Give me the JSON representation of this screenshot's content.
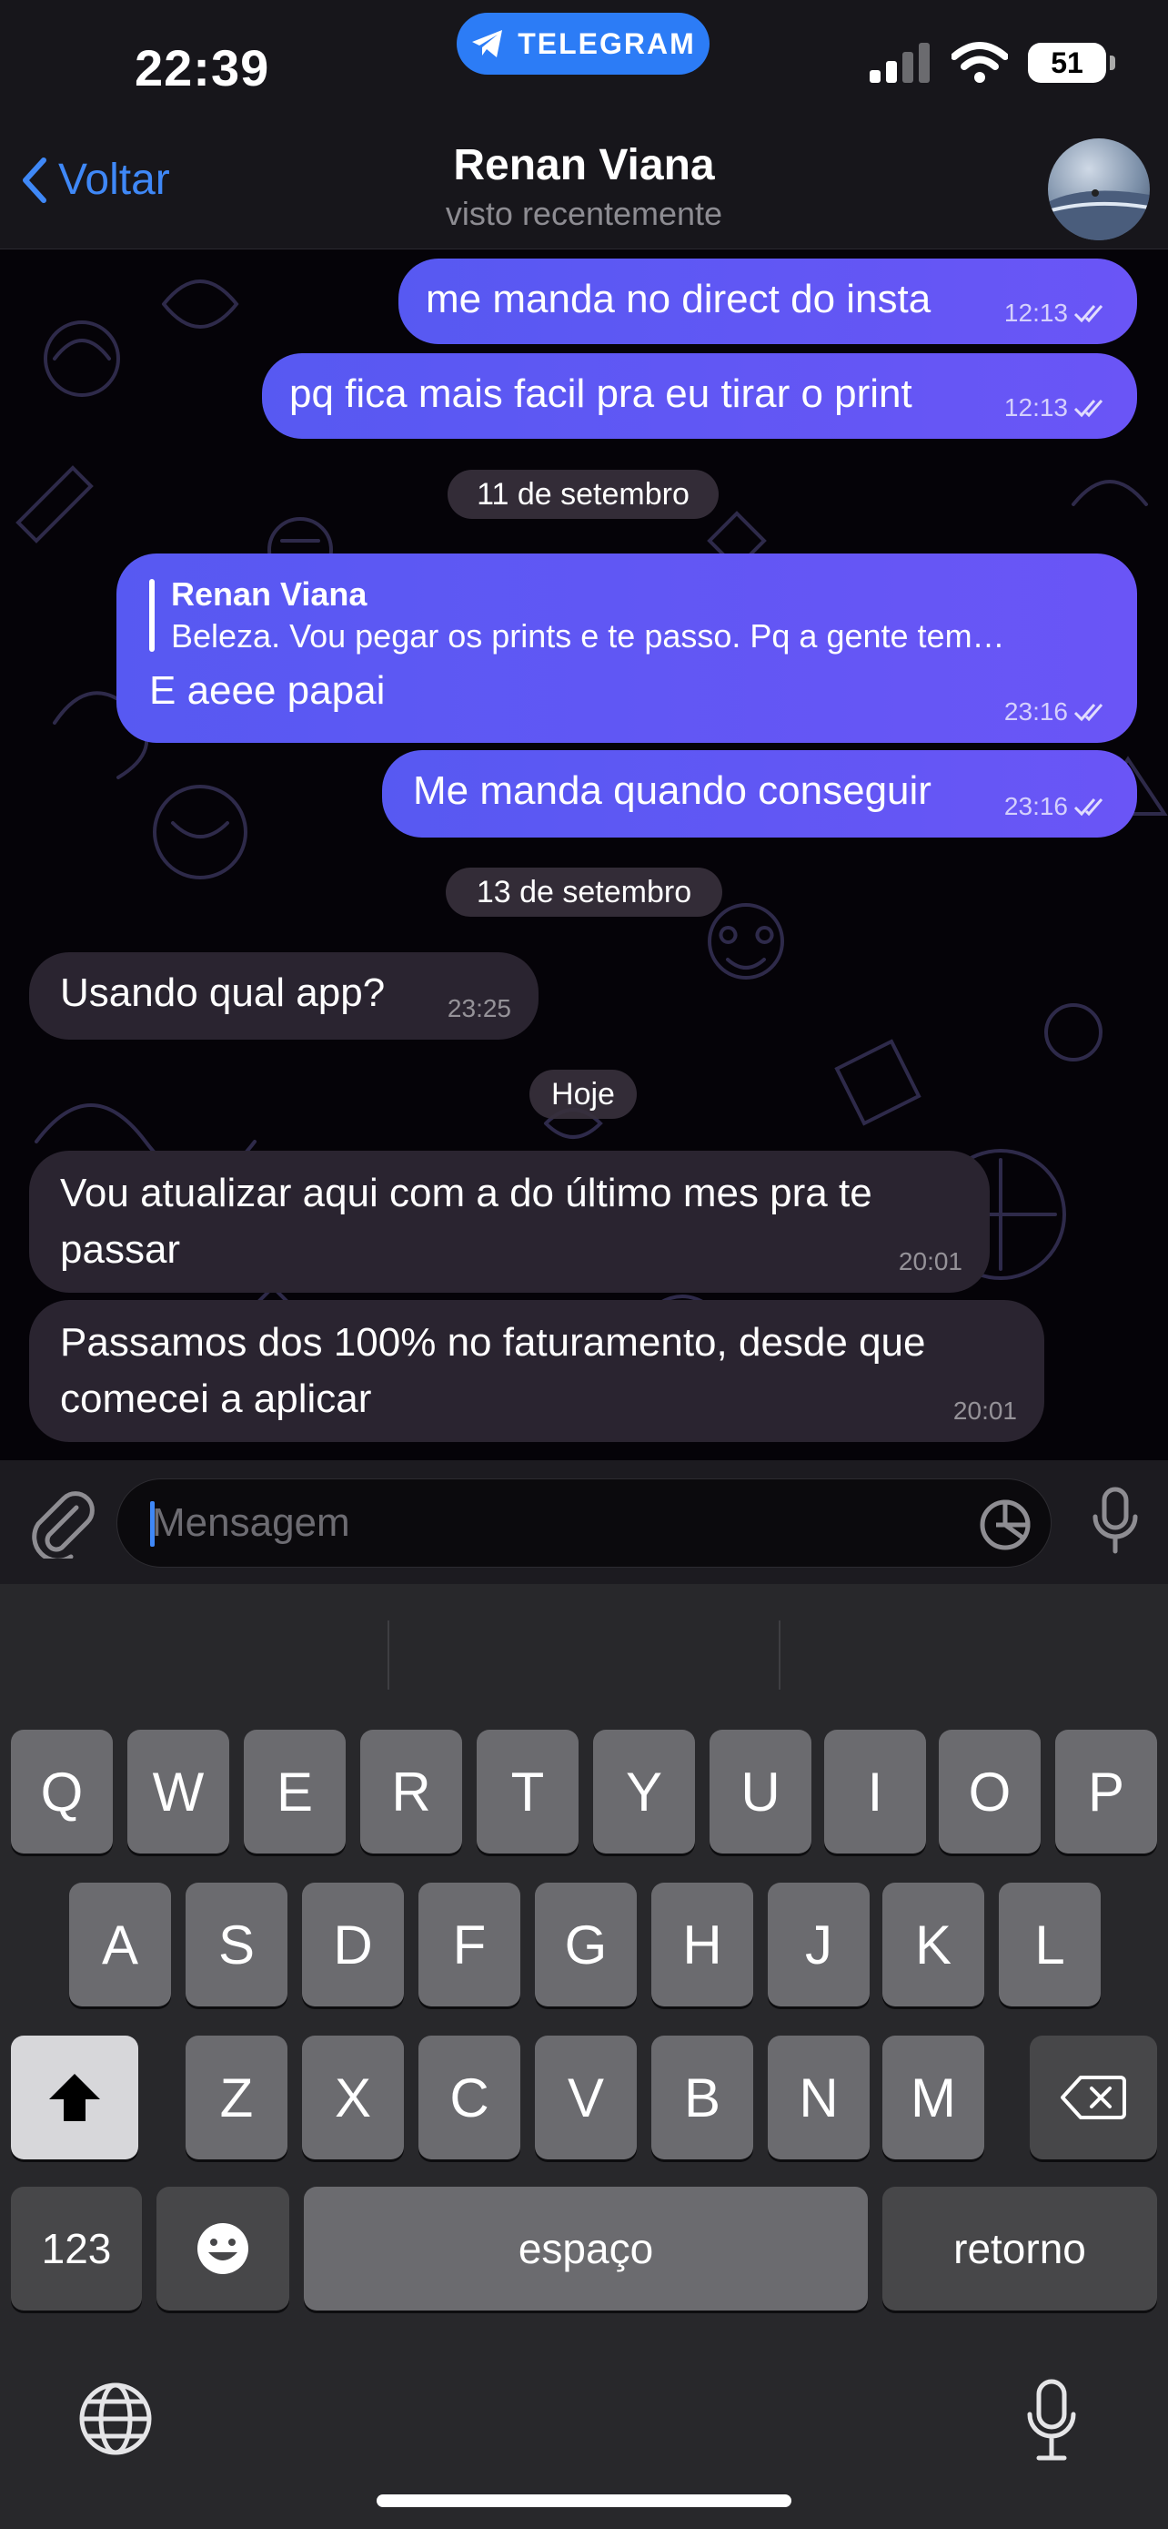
{
  "status_bar": {
    "time": "22:39",
    "app_pill": "TELEGRAM",
    "battery": "51"
  },
  "header": {
    "back_label": "Voltar",
    "contact_name": "Renan Viana",
    "contact_status": "visto recentemente"
  },
  "messages": [
    {
      "dir": "out",
      "text": "me manda no direct do insta",
      "time": "12:13"
    },
    {
      "dir": "out",
      "text": "pq fica mais facil pra eu tirar o print",
      "time": "12:13"
    },
    {
      "date_chip": "11 de setembro"
    },
    {
      "dir": "out",
      "reply_name": "Renan Viana",
      "reply_text": "Beleza. Vou pegar os prints e te passo. Pq a gente tem…",
      "text": "E aeee papai",
      "time": "23:16"
    },
    {
      "dir": "out",
      "text": "Me manda quando conseguir",
      "time": "23:16"
    },
    {
      "date_chip": "13 de setembro"
    },
    {
      "dir": "in",
      "text": "Usando qual app?",
      "time": "23:25"
    },
    {
      "date_chip": "Hoje"
    },
    {
      "dir": "in",
      "text": "Vou atualizar aqui com a do último mes pra te passar",
      "time": "20:01"
    },
    {
      "dir": "in",
      "text": "Passamos dos 100% no faturamento, desde que comecei a aplicar",
      "time": "20:01"
    }
  ],
  "input": {
    "placeholder": "Mensagem"
  },
  "keyboard": {
    "row1": [
      "Q",
      "W",
      "E",
      "R",
      "T",
      "Y",
      "U",
      "I",
      "O",
      "P"
    ],
    "row2": [
      "A",
      "S",
      "D",
      "F",
      "G",
      "H",
      "J",
      "K",
      "L"
    ],
    "row3": [
      "Z",
      "X",
      "C",
      "V",
      "B",
      "N",
      "M"
    ],
    "numbers_label": "123",
    "space_label": "espaço",
    "return_label": "retorno"
  },
  "colors": {
    "outgoing_bubble": "#5f57f4",
    "incoming_bubble": "#2a2430",
    "accent": "#3f88f7",
    "telegram_pill": "#2c7cf6"
  },
  "icons": [
    "telegram-icon",
    "signal-icon",
    "wifi-icon",
    "battery-icon",
    "back-chevron-icon",
    "double-check-icon",
    "attach-icon",
    "sticker-icon",
    "microphone-icon",
    "shift-icon",
    "backspace-icon",
    "emoji-icon",
    "globe-icon",
    "dictation-icon"
  ]
}
